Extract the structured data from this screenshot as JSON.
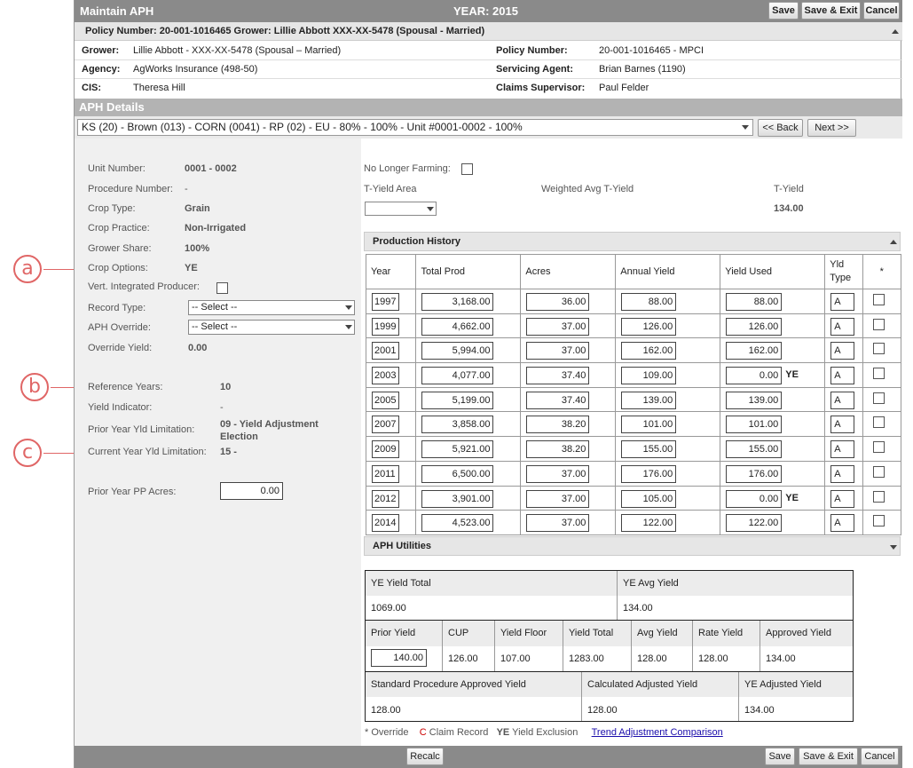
{
  "window": {
    "title": "Maintain APH",
    "year_label": "YEAR: 2015",
    "save": "Save",
    "save_exit": "Save & Exit",
    "cancel": "Cancel"
  },
  "policy_header": "Policy Number: 20-001-1016465 Grower: Lillie Abbott XXX-XX-5478 (Spousal - Married)",
  "info": {
    "grower_label": "Grower:",
    "grower": "Lillie Abbott - XXX-XX-5478 (Spousal – Married)",
    "policy_label": "Policy Number:",
    "policy": "20-001-1016465 - MPCI",
    "agency_label": "Agency:",
    "agency": "AgWorks Insurance (498-50)",
    "agent_label": "Servicing Agent:",
    "agent": "Brian Barnes (1190)",
    "cis_label": "CIS:",
    "cis": "Theresa Hill",
    "claims_label": "Claims Supervisor:",
    "claims": "Paul Felder"
  },
  "aph_details": {
    "title": "APH Details",
    "unit_select": "KS (20) - Brown (013) - CORN (0041) - RP (02) - EU - 80% - 100% - Unit #0001-0002 - 100%",
    "back": "<< Back",
    "next": "Next >>"
  },
  "left": {
    "unit_number_label": "Unit Number:",
    "unit_number": "0001 - 0002",
    "procedure_label": "Procedure Number:",
    "procedure": "-",
    "crop_type_label": "Crop Type:",
    "crop_type": "Grain",
    "crop_practice_label": "Crop Practice:",
    "crop_practice": "Non-Irrigated",
    "grower_share_label": "Grower Share:",
    "grower_share": "100%",
    "crop_options_label": "Crop Options:",
    "crop_options": "YE",
    "vip_label": "Vert. Integrated Producer:",
    "record_type_label": "Record Type:",
    "record_type": "-- Select --",
    "aph_override_label": "APH Override:",
    "aph_override": "-- Select --",
    "override_yield_label": "Override Yield:",
    "override_yield": "0.00",
    "ref_years_label": "Reference Years:",
    "ref_years": "10",
    "yield_indicator_label": "Yield Indicator:",
    "yield_indicator": "-",
    "prior_lim_label": "Prior Year Yld Limitation:",
    "prior_lim": "09 - Yield Adjustment Election",
    "current_lim_label": "Current Year Yld Limitation:",
    "current_lim": "15 -",
    "pp_acres_label": "Prior Year PP Acres:",
    "pp_acres": "0.00"
  },
  "right": {
    "no_longer_farming": "No Longer Farming:",
    "tyield_area": "T-Yield Area",
    "weighted_avg": "Weighted Avg T-Yield",
    "tyield_label": "T-Yield",
    "tyield": "134.00"
  },
  "production_history": {
    "title": "Production History",
    "headers": [
      "Year",
      "Total Prod",
      "Acres",
      "Annual Yield",
      "Yield Used",
      "Yld Type",
      "*"
    ],
    "rows": [
      {
        "year": "1997",
        "prod": "3,168.00",
        "acres": "36.00",
        "annual": "88.00",
        "used": "88.00",
        "flag": "",
        "type": "A"
      },
      {
        "year": "1999",
        "prod": "4,662.00",
        "acres": "37.00",
        "annual": "126.00",
        "used": "126.00",
        "flag": "",
        "type": "A"
      },
      {
        "year": "2001",
        "prod": "5,994.00",
        "acres": "37.00",
        "annual": "162.00",
        "used": "162.00",
        "flag": "",
        "type": "A"
      },
      {
        "year": "2003",
        "prod": "4,077.00",
        "acres": "37.40",
        "annual": "109.00",
        "used": "0.00",
        "flag": "YE",
        "type": "A"
      },
      {
        "year": "2005",
        "prod": "5,199.00",
        "acres": "37.40",
        "annual": "139.00",
        "used": "139.00",
        "flag": "",
        "type": "A"
      },
      {
        "year": "2007",
        "prod": "3,858.00",
        "acres": "38.20",
        "annual": "101.00",
        "used": "101.00",
        "flag": "",
        "type": "A"
      },
      {
        "year": "2009",
        "prod": "5,921.00",
        "acres": "38.20",
        "annual": "155.00",
        "used": "155.00",
        "flag": "",
        "type": "A"
      },
      {
        "year": "2011",
        "prod": "6,500.00",
        "acres": "37.00",
        "annual": "176.00",
        "used": "176.00",
        "flag": "",
        "type": "A"
      },
      {
        "year": "2012",
        "prod": "3,901.00",
        "acres": "37.00",
        "annual": "105.00",
        "used": "0.00",
        "flag": "YE",
        "type": "A"
      },
      {
        "year": "2014",
        "prod": "4,523.00",
        "acres": "37.00",
        "annual": "122.00",
        "used": "122.00",
        "flag": "",
        "type": "A"
      }
    ]
  },
  "utilities": {
    "title": "APH Utilities",
    "ye_total_label": "YE Yield Total",
    "ye_total": "1069.00",
    "ye_avg_label": "YE Avg Yield",
    "ye_avg": "134.00",
    "prior_yield_label": "Prior Yield",
    "prior_yield": "140.00",
    "cup_label": "CUP",
    "cup": "126.00",
    "floor_label": "Yield Floor",
    "floor": "107.00",
    "total_label": "Yield Total",
    "total": "1283.00",
    "avg_label": "Avg Yield",
    "avg": "128.00",
    "rate_label": "Rate Yield",
    "rate": "128.00",
    "approved_label": "Approved Yield",
    "approved": "134.00",
    "std_label": "Standard Procedure Approved Yield",
    "std": "128.00",
    "calc_label": "Calculated Adjusted Yield",
    "calc": "128.00",
    "ye_adj_label": "YE Adjusted Yield",
    "ye_adj": "134.00"
  },
  "legend": {
    "override": "* Override",
    "claim_c": "C",
    "claim": "Claim Record",
    "ye": "YE",
    "ye_text": "Yield Exclusion",
    "trend_link": "Trend Adjustment Comparison"
  },
  "footer": {
    "recalc": "Recalc",
    "save": "Save",
    "save_exit": "Save & Exit",
    "cancel": "Cancel"
  },
  "callouts": {
    "a": "a",
    "b": "b",
    "c": "c"
  },
  "colors": {
    "accent_red": "#e06666",
    "header_gray": "#8a8a8a",
    "link_blue": "#1a0dab"
  }
}
